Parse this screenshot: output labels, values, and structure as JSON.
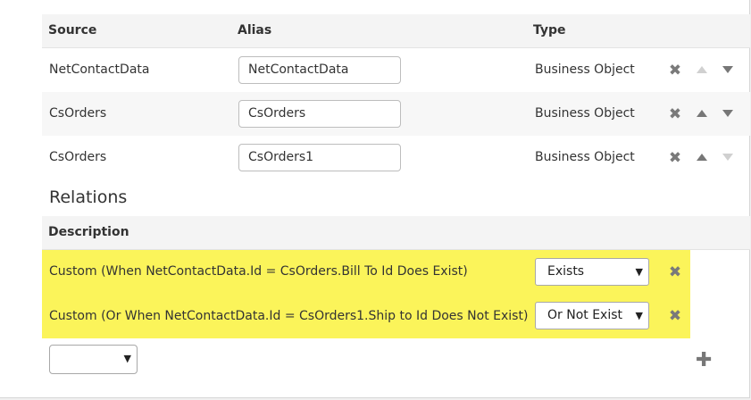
{
  "sources_table": {
    "headers": {
      "source": "Source",
      "alias": "Alias",
      "type": "Type"
    },
    "rows": [
      {
        "source": "NetContactData",
        "alias": "NetContactData",
        "type": "Business Object",
        "up_enabled": false,
        "down_enabled": true
      },
      {
        "source": "CsOrders",
        "alias": "CsOrders",
        "type": "Business Object",
        "up_enabled": true,
        "down_enabled": true
      },
      {
        "source": "CsOrders",
        "alias": "CsOrders1",
        "type": "Business Object",
        "up_enabled": true,
        "down_enabled": false
      }
    ]
  },
  "relations": {
    "title": "Relations",
    "header": "Description",
    "rows": [
      {
        "description": "Custom (When NetContactData.Id = CsOrders.Bill To Id Does Exist)",
        "mode": "Exists"
      },
      {
        "description": "Custom (Or When NetContactData.Id = CsOrders1.Ship to Id Does Not Exist)",
        "mode": "Or Not Exist"
      }
    ],
    "new_relation_select_value": ""
  },
  "icons": {
    "remove": "close-icon",
    "move_up": "triangle-up-icon",
    "move_down": "triangle-down-icon",
    "add": "plus-icon"
  },
  "colors": {
    "highlight": "#fbf45a",
    "header_bg": "#f4f4f4",
    "icon": "#777777",
    "icon_disabled": "#d0d0d0"
  }
}
